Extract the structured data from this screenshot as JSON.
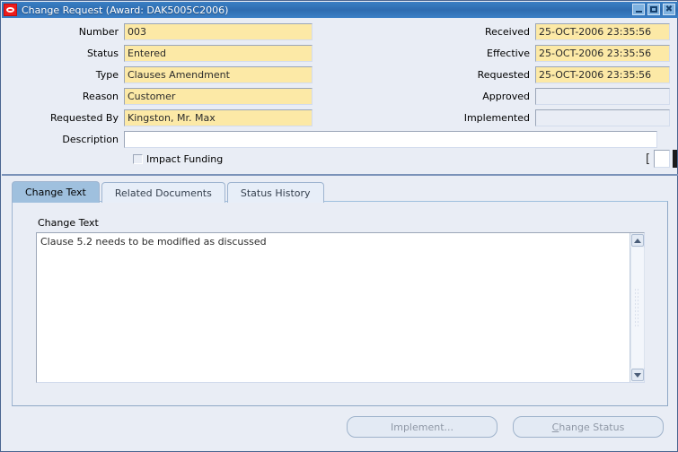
{
  "window": {
    "title": "Change Request (Award: DAK5005C2006)",
    "icon": "oracle-forms-icon",
    "controls": {
      "minimize": "minimize",
      "maximize": "maximize",
      "close": "close"
    },
    "accent_color": "#2e6cb0",
    "background_color": "#e9edf5",
    "field_yellow": "#fce9a6"
  },
  "form": {
    "left_fields": [
      {
        "label": "Number",
        "value": "003",
        "style": "yellow"
      },
      {
        "label": "Status",
        "value": "Entered",
        "style": "yellow"
      },
      {
        "label": "Type",
        "value": "Clauses Amendment",
        "style": "yellow"
      },
      {
        "label": "Reason",
        "value": "Customer",
        "style": "yellow"
      },
      {
        "label": "Requested By",
        "value": "Kingston, Mr. Max",
        "style": "yellow"
      }
    ],
    "description": {
      "label": "Description",
      "value": "",
      "style": "white"
    },
    "right_fields": [
      {
        "label": "Received",
        "value": "25-OCT-2006 23:35:56",
        "style": "yellow"
      },
      {
        "label": "Effective",
        "value": "25-OCT-2006 23:35:56",
        "style": "yellow"
      },
      {
        "label": "Requested",
        "value": "25-OCT-2006 23:35:56",
        "style": "yellow"
      },
      {
        "label": "Approved",
        "value": "",
        "style": "grey"
      },
      {
        "label": "Implemented",
        "value": "",
        "style": "grey"
      }
    ],
    "impact_funding": {
      "label": "Impact Funding",
      "checked": false
    },
    "edge_widget": {
      "bracket": "["
    }
  },
  "tabs": [
    {
      "label": "Change Text",
      "active": true
    },
    {
      "label": "Related Documents",
      "active": false
    },
    {
      "label": "Status History",
      "active": false
    }
  ],
  "change_text_panel": {
    "label": "Change Text",
    "value": "Clause 5.2 needs to be modified as discussed"
  },
  "buttons": {
    "implement": {
      "label": "Implement...",
      "enabled": false
    },
    "change_status": {
      "label": "Change Status",
      "mnemonic": "C",
      "enabled": false
    }
  }
}
